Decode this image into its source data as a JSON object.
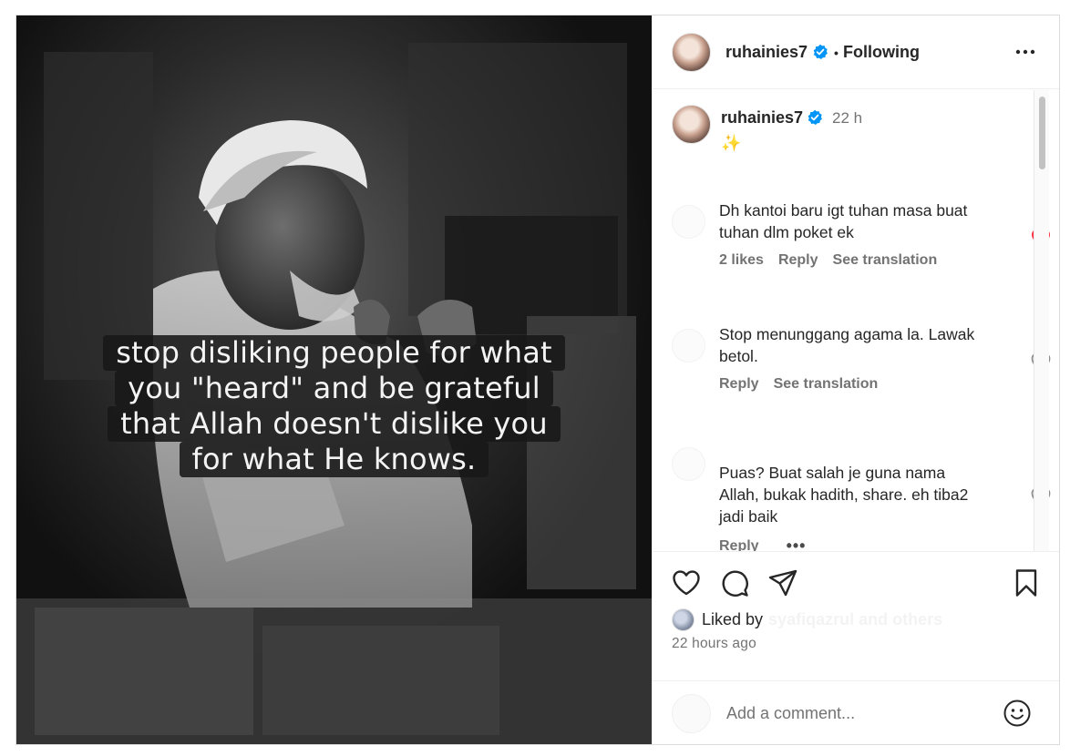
{
  "header": {
    "username": "ruhainies7",
    "separator": "•",
    "follow_status": "Following"
  },
  "post": {
    "caption_author": "ruhainies7",
    "caption_time": "22 h",
    "caption_text": "✨",
    "image_overlay_lines": [
      "stop disliking people for what",
      "you \"heard\" and be grateful",
      "that Allah doesn't dislike you",
      "for what He knows."
    ]
  },
  "comments": [
    {
      "text": "Dh kantoi baru igt tuhan masa buat tuhan dlm poket ek",
      "likes": "2 likes",
      "reply": "Reply",
      "translate": "See translation",
      "liked": true
    },
    {
      "text": "Stop menunggang agama la. Lawak betol.",
      "reply": "Reply",
      "translate": "See translation",
      "liked": false
    },
    {
      "text": "Puas? Buat salah je guna nama Allah, bukak hadith, share. eh tiba2 jadi baik",
      "reply": "Reply",
      "more": "•••",
      "liked": false
    }
  ],
  "engagement": {
    "liked_by_label": "Liked by",
    "liked_by_names": "syafiqazrul and others",
    "post_age": "22 hours ago"
  },
  "composer": {
    "placeholder": "Add a comment..."
  },
  "colors": {
    "verified": "#0095f6",
    "liked_heart": "#ff3040",
    "secondary_text": "#737373"
  },
  "icons": {
    "actions": [
      "heart-icon",
      "comment-icon",
      "share-icon",
      "bookmark-icon"
    ],
    "composer": "emoji-icon",
    "header": "more-options-icon"
  }
}
